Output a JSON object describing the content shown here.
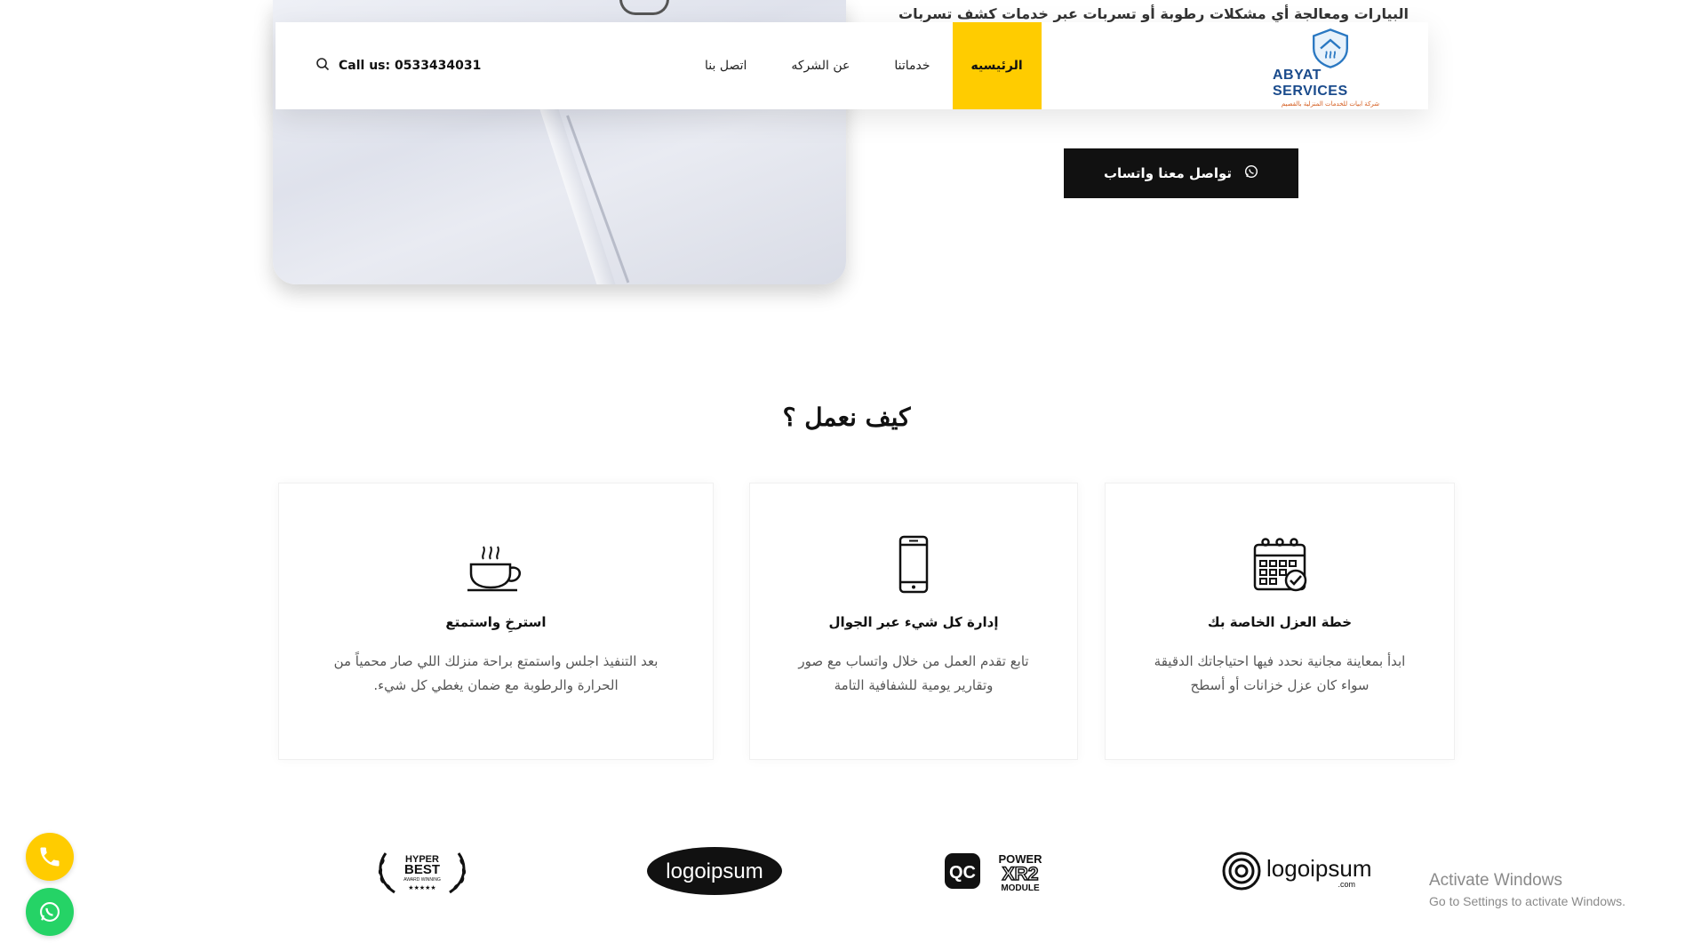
{
  "hero": {
    "text": "البيارات ومعالجة أي مشكلات رطوبة أو تسربات عبر خدمات كشف تسربات",
    "whatsapp_button": "تواصل معنا واتساب"
  },
  "navbar": {
    "call_label": "Call us: 0533434031",
    "links": [
      "الرئيسيه",
      "خدماتنا",
      "عن الشركه",
      "اتصل بنا"
    ],
    "logo_text": "ABYAT SERVICES",
    "logo_sub": "شركة ابيات للخدمات المنزلية بالقصيم"
  },
  "section": {
    "title": "كيف نعمل ؟"
  },
  "cards": [
    {
      "icon": "calendar-icon",
      "title": "خطة العزل الخاصة بك",
      "desc_1": "ابدأ بمعاينة مجانية نحدد فيها احتياجاتك الدقيقة",
      "desc_2": "سواء كان عزل خزانات أو أسطح"
    },
    {
      "icon": "mobile-phone-icon",
      "title": "إدارة كل شيء عبر الجوال",
      "desc_1": "تابع تقدم العمل من خلال واتساب مع صور",
      "desc_2": "وتقارير يومية للشفافية التامة"
    },
    {
      "icon": "coffee-cup-icon",
      "title": "استرخِ واستمتع",
      "desc_1": "بعد التنفيذ اجلس واستمتع براحة منزلك اللي صار محمياً من",
      "desc_2": "الحرارة والرطوبة مع ضمان يغطي كل شيء."
    }
  ],
  "brands": {
    "b1": "logoipsum",
    "b1_sub": ".com",
    "b2_top": "POWER",
    "b2_mid": "XR2",
    "b2_bot": "MODULE",
    "b2_badge": "QC",
    "b3": "logoipsum",
    "b4_1": "HYPER",
    "b4_2": "BEST",
    "b4_3": "AWARD WINNING",
    "b4_4": "★★★★★"
  },
  "windows": {
    "line1": "Activate Windows",
    "line2": "Go to Settings to activate Windows."
  },
  "colors": {
    "accent": "#ffcc00",
    "dark": "#111111",
    "whatsapp": "#25d366"
  }
}
